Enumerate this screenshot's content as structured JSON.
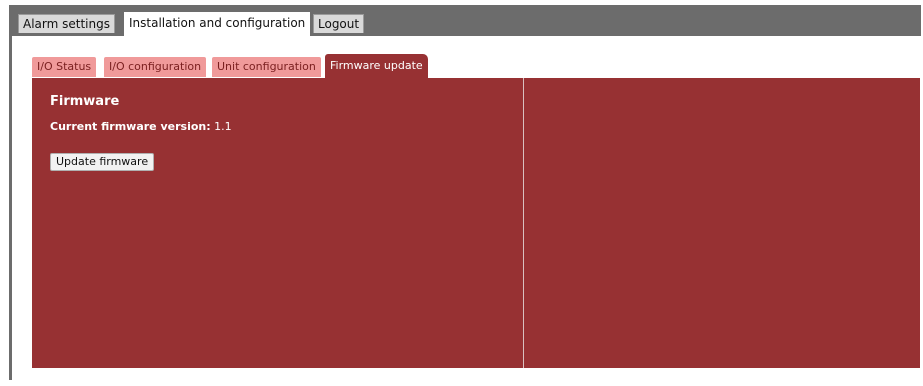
{
  "main_tabs": [
    {
      "label": "Alarm settings",
      "active": false
    },
    {
      "label": "Installation and configuration",
      "active": true
    },
    {
      "label": "Logout",
      "active": false
    }
  ],
  "sub_tabs": [
    {
      "label": "I/O Status",
      "active": false
    },
    {
      "label": "I/O configuration",
      "active": false
    },
    {
      "label": "Unit configuration",
      "active": false
    },
    {
      "label": "Firmware update",
      "active": true
    }
  ],
  "firmware": {
    "title": "Firmware",
    "version_label": "Current firmware version:",
    "version_value": "1.1",
    "update_button": "Update firmware"
  },
  "colors": {
    "header_gray": "#6c6c6c",
    "panel_red": "#973133",
    "inactive_subtab": "#f09a9a"
  }
}
